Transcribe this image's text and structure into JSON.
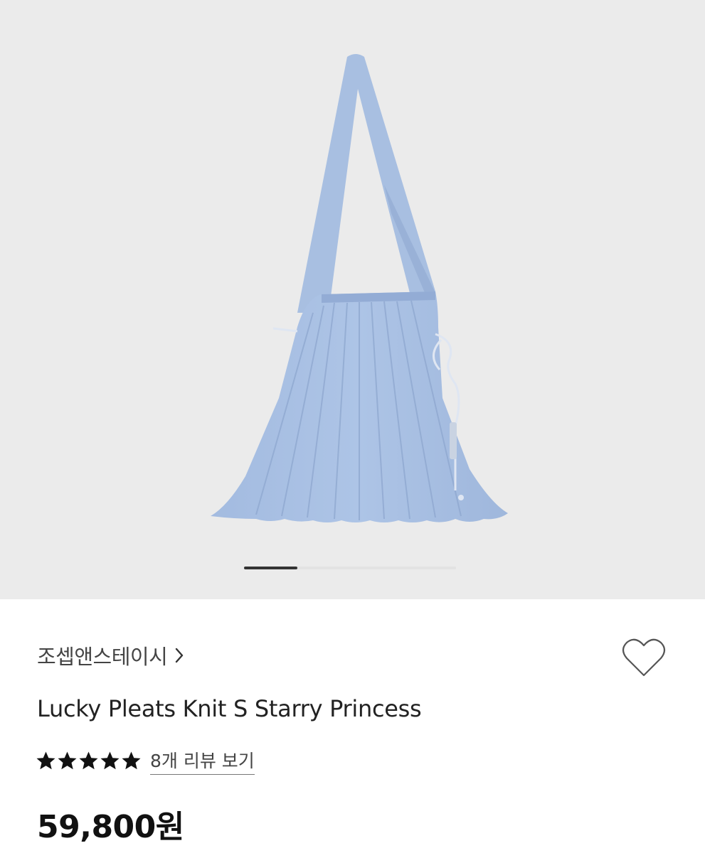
{
  "gallery": {
    "image_alt": "",
    "current_slide_fraction": 0.25
  },
  "product": {
    "brand": "조셉앤스테이시",
    "title": "Lucky Pleats Knit S Starry Princess",
    "rating_stars": 5,
    "review_link": "8개 리뷰 보기",
    "price": "59,800원"
  },
  "colors": {
    "gallery_bg": "#ebebeb",
    "bag_blue": "#a9c0e2",
    "text": "#111111"
  },
  "icons": {
    "brand_chevron": "chevron-right-icon",
    "wishlist": "heart-outline-icon",
    "star": "star-filled-icon"
  }
}
